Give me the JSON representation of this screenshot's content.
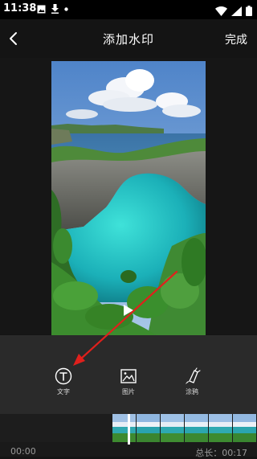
{
  "status_bar": {
    "time": "11:38"
  },
  "header": {
    "title": "添加水印",
    "done_label": "完成"
  },
  "tools": [
    {
      "label": "文字",
      "icon": "text-t-icon"
    },
    {
      "label": "图片",
      "icon": "image-icon"
    },
    {
      "label": "涂鸦",
      "icon": "doodle-brush-icon"
    }
  ],
  "timeline": {
    "current_time": "00:00",
    "total_duration": "总长：00:17"
  },
  "colors": {
    "annotation_arrow": "#e0201c",
    "background": "#141414",
    "toolbar": "#2a2a2a"
  }
}
